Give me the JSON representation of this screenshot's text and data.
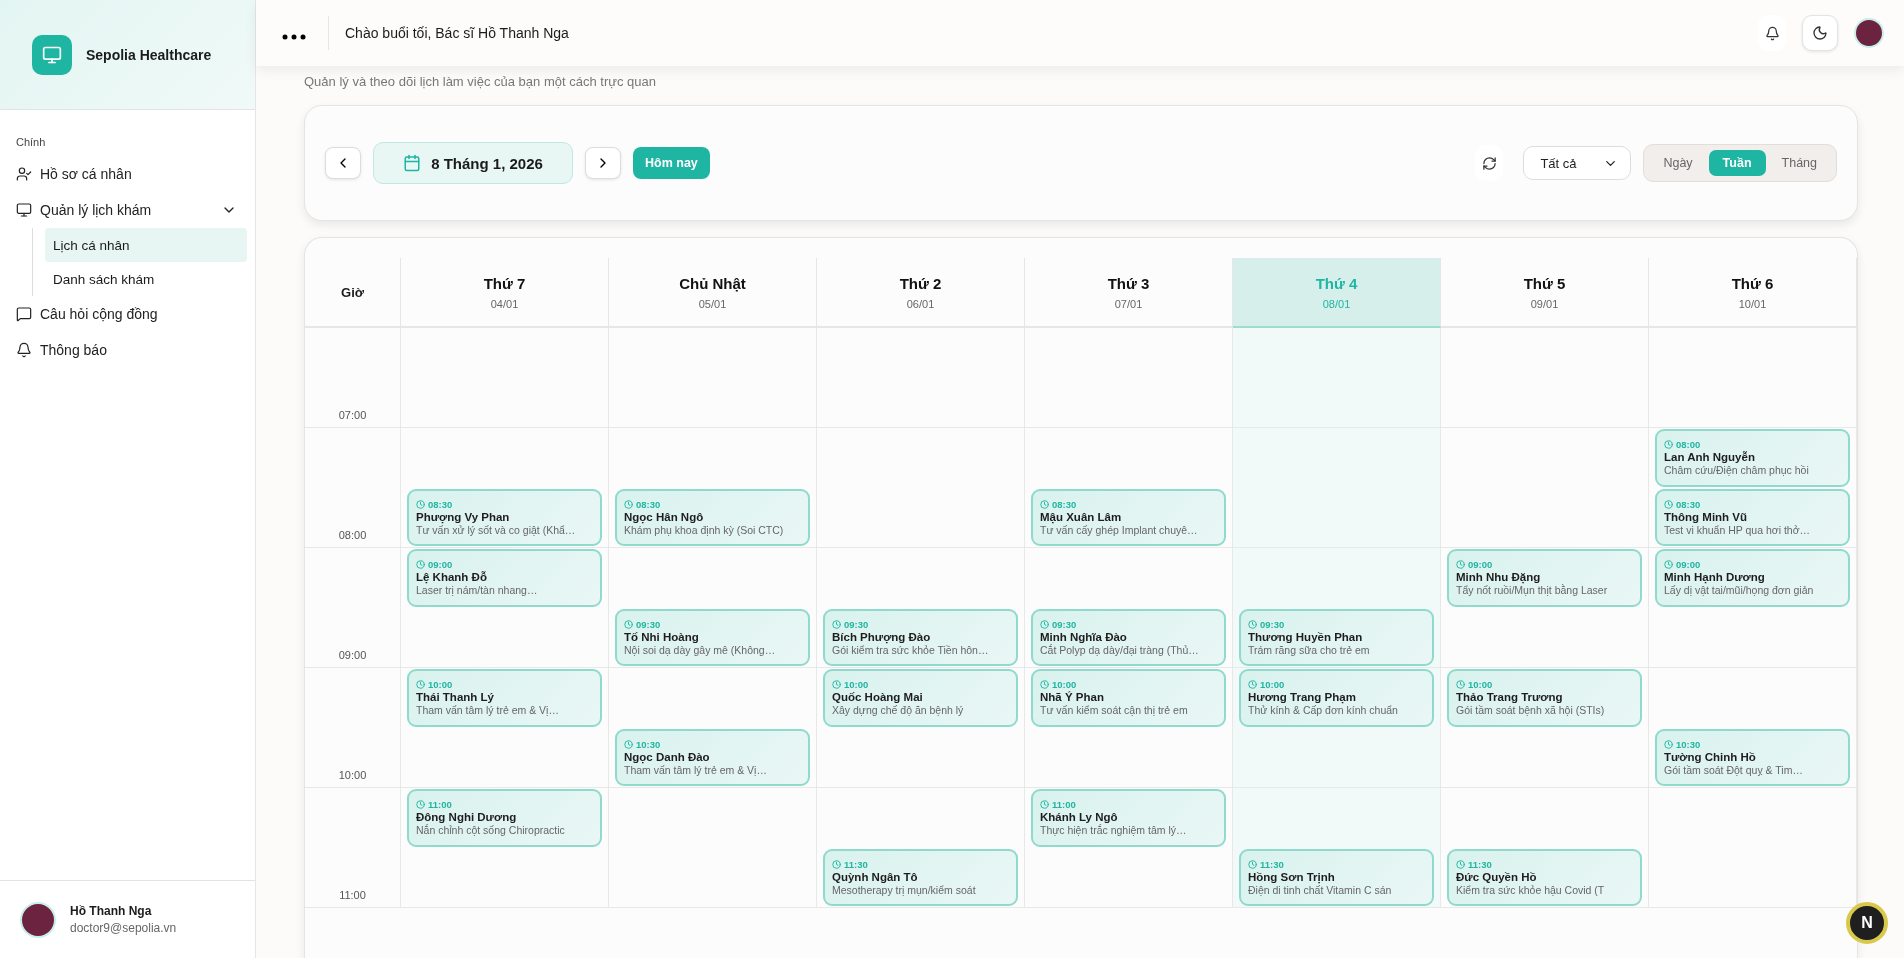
{
  "brand": {
    "name": "Sepolia Healthcare"
  },
  "sidebar": {
    "section": "Chính",
    "items": [
      {
        "label": "Hồ sơ cá nhân",
        "kind": "user",
        "selected": false
      },
      {
        "label": "Quản lý lịch khám",
        "kind": "monitor",
        "selected": false,
        "expanded": true,
        "children": [
          {
            "label": "Lịch cá nhân",
            "selected": true
          },
          {
            "label": "Danh sách khám",
            "selected": false
          }
        ]
      },
      {
        "label": "Câu hỏi cộng đồng",
        "kind": "message",
        "selected": false
      },
      {
        "label": "Thông báo",
        "kind": "bell",
        "selected": false
      }
    ]
  },
  "user": {
    "name": "Hồ Thanh Nga",
    "email": "doctor9@sepolia.vn"
  },
  "header": {
    "greeting": "Chào buổi tối, Bác sĩ Hồ Thanh Nga"
  },
  "subtitle": "Quản lý và theo dõi lịch làm việc của bạn một cách trực quan",
  "toolbar": {
    "date": "8 Tháng 1, 2026",
    "today": "Hôm nay",
    "filter": "Tất cả",
    "views": [
      {
        "label": "Ngày",
        "selected": false
      },
      {
        "label": "Tuần",
        "selected": true
      },
      {
        "label": "Tháng",
        "selected": false
      }
    ]
  },
  "calendar": {
    "time_heading": "Giờ",
    "hours": [
      "07:00",
      "08:00",
      "09:00",
      "10:00",
      "11:00"
    ],
    "days": [
      {
        "name": "Thứ 7",
        "date": "04/01",
        "selected": false,
        "events": [
          {
            "time": "08:30",
            "patient": "Phượng Vy Phan",
            "service": "Tư vấn xử lý sốt và co giật (Khẩ…"
          },
          {
            "time": "09:00",
            "patient": "Lệ Khanh Đỗ",
            "service": "Laser trị nám/tàn nhang…"
          },
          {
            "time": "10:00",
            "patient": "Thái Thanh Lý",
            "service": "Tham vấn tâm lý trẻ em & Vị…"
          },
          {
            "time": "11:00",
            "patient": "Đông Nghi Dương",
            "service": "Nắn chỉnh cột sống Chiropractic"
          }
        ]
      },
      {
        "name": "Chủ Nhật",
        "date": "05/01",
        "selected": false,
        "events": [
          {
            "time": "08:30",
            "patient": "Ngọc Hân Ngô",
            "service": "Khám phụ khoa định kỳ (Soi CTC)"
          },
          {
            "time": "09:30",
            "patient": "Tố Nhi Hoàng",
            "service": "Nội soi dạ dày gây mê (Không…"
          },
          {
            "time": "10:30",
            "patient": "Ngọc Danh Đào",
            "service": "Tham vấn tâm lý trẻ em & Vị…"
          }
        ]
      },
      {
        "name": "Thứ 2",
        "date": "06/01",
        "selected": false,
        "events": [
          {
            "time": "09:30",
            "patient": "Bích Phượng Đào",
            "service": "Gói kiểm tra sức khỏe Tiền hôn…"
          },
          {
            "time": "10:00",
            "patient": "Quốc Hoàng Mai",
            "service": "Xây dựng chế độ ăn bệnh lý"
          },
          {
            "time": "11:30",
            "patient": "Quỳnh Ngân Tô",
            "service": "Mesotherapy trị mụn/kiểm soát"
          }
        ]
      },
      {
        "name": "Thứ 3",
        "date": "07/01",
        "selected": false,
        "events": [
          {
            "time": "08:30",
            "patient": "Mậu Xuân Lâm",
            "service": "Tư vấn cấy ghép Implant chuyê…"
          },
          {
            "time": "09:30",
            "patient": "Minh Nghĩa Đào",
            "service": "Cắt Polyp dạ dày/đại tràng (Thủ…"
          },
          {
            "time": "10:00",
            "patient": "Nhã Ý Phan",
            "service": "Tư vấn kiểm soát cận thị trẻ em"
          },
          {
            "time": "11:00",
            "patient": "Khánh Ly Ngô",
            "service": "Thực hiện trắc nghiệm tâm lý…"
          }
        ]
      },
      {
        "name": "Thứ 4",
        "date": "08/01",
        "selected": true,
        "events": [
          {
            "time": "09:30",
            "patient": "Thương Huyền Phan",
            "service": "Trám răng sữa cho trẻ em"
          },
          {
            "time": "10:00",
            "patient": "Hương Trang Phạm",
            "service": "Thử kính & Cấp đơn kính chuẩn"
          },
          {
            "time": "11:30",
            "patient": "Hồng Sơn Trịnh",
            "service": "Điện di tinh chất Vitamin C sán"
          }
        ]
      },
      {
        "name": "Thứ 5",
        "date": "09/01",
        "selected": false,
        "events": [
          {
            "time": "09:00",
            "patient": "Minh Nhu Đặng",
            "service": "Tẩy nốt ruồi/Mụn thịt bằng Laser"
          },
          {
            "time": "10:00",
            "patient": "Thảo Trang Trương",
            "service": "Gói tầm soát bệnh xã hội (STIs)"
          },
          {
            "time": "11:30",
            "patient": "Đức Quyền Hồ",
            "service": "Kiểm tra sức khỏe hậu Covid (T"
          }
        ]
      },
      {
        "name": "Thứ 6",
        "date": "10/01",
        "selected": false,
        "events": [
          {
            "time": "08:00",
            "patient": "Lan Anh Nguyễn",
            "service": "Châm cứu/Điện châm phục hồi"
          },
          {
            "time": "08:30",
            "patient": "Thông Minh Vũ",
            "service": "Test vi khuẩn HP qua hơi thở…"
          },
          {
            "time": "09:00",
            "patient": "Minh Hạnh Dương",
            "service": "Lấy dị vật tai/mũi/họng đơn giản"
          },
          {
            "time": "10:30",
            "patient": "Tường Chinh Hồ",
            "service": "Gói tầm soát Đột quỵ & Tim…"
          }
        ]
      }
    ]
  },
  "floating_badge": "N"
}
